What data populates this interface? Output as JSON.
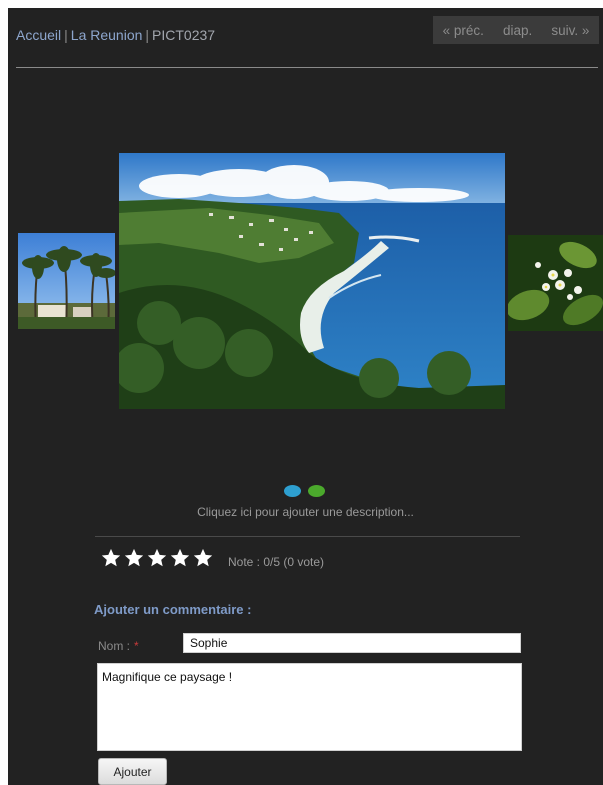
{
  "breadcrumb": {
    "home": "Accueil",
    "album": "La Reunion",
    "separator": "|",
    "current": "PICT0237"
  },
  "nav": {
    "prev": "« préc.",
    "slideshow": "diap.",
    "next": "suiv. »"
  },
  "gallery": {
    "description_placeholder": "Cliquez ici pour ajouter une description...",
    "indicator_colors": [
      "#2e9fd0",
      "#4ba92c"
    ]
  },
  "rating": {
    "stars": 5,
    "text": "Note : 0/5 (0 vote)"
  },
  "comment_form": {
    "title": "Ajouter un commentaire :",
    "name_label": "Nom :",
    "required_mark": "*",
    "name_value": "Sophie",
    "comment_value": "Magnifique ce paysage !",
    "submit_label": "Ajouter"
  },
  "colors": {
    "background": "#222222",
    "link": "#8da6cd",
    "heading": "#7f9bc8"
  }
}
